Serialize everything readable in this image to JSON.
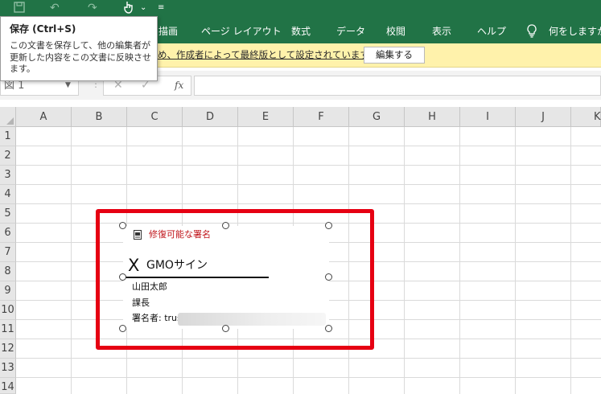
{
  "quick_access": {
    "icons": [
      "save-icon",
      "undo-icon",
      "redo-icon",
      "touch-mode-icon",
      "customize-qat-icon"
    ]
  },
  "ribbon": {
    "tabs": [
      "描画",
      "ページ レイアウト",
      "数式",
      "データ",
      "校閲",
      "表示",
      "ヘルプ"
    ],
    "tell_me": "何をしますか"
  },
  "message_bar": {
    "text": "め、作成者によって最終版として設定されています。",
    "edit_button": "編集する"
  },
  "formula_bar": {
    "name_box": "図 1",
    "fx_label": "fx",
    "formula": ""
  },
  "sheet": {
    "columns": [
      "A",
      "B",
      "C",
      "D",
      "E",
      "F",
      "G",
      "H",
      "I",
      "J",
      "K"
    ],
    "rows": [
      "1",
      "2",
      "3",
      "4",
      "5",
      "6",
      "7",
      "8",
      "9",
      "10",
      "11",
      "12",
      "13",
      "14"
    ]
  },
  "signature": {
    "title": "修復可能な署名",
    "x_mark": "X",
    "name": "GMOサイン",
    "line1": "山田太郎",
    "line2": "課長",
    "line3": "署名者: trust_"
  },
  "tooltip": {
    "title": "保存 (Ctrl+S)",
    "body": "この文書を保存して、他の編集者が更新した内容をこの文書に反映させます。"
  },
  "colors": {
    "ribbon_green": "#217346",
    "message_bar_yellow": "#fff2ab",
    "highlight_red": "#e60012"
  }
}
